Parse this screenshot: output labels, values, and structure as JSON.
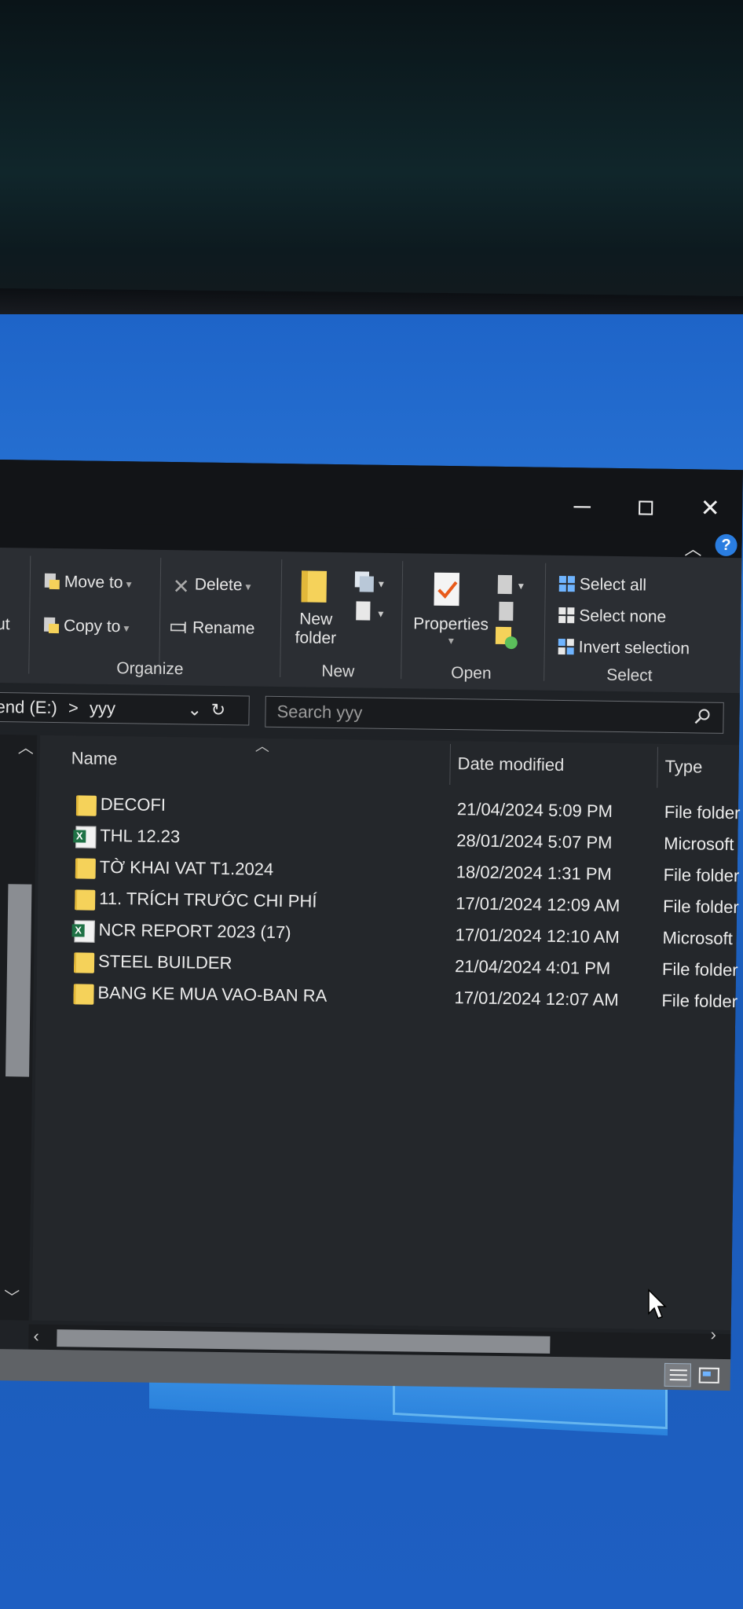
{
  "window": {
    "minimize_glyph": "─",
    "close_glyph": "✕"
  },
  "ribbon": {
    "cut_partial": "ut",
    "move_to": "Move to",
    "copy_to": "Copy to",
    "delete": "Delete",
    "rename": "Rename",
    "new_folder_line1": "New",
    "new_folder_line2": "folder",
    "properties": "Properties",
    "select_all": "Select all",
    "select_none": "Select none",
    "invert_selection": "Invert selection",
    "groups": {
      "organize": "Organize",
      "new": "New",
      "open": "Open",
      "select": "Select"
    }
  },
  "address": {
    "drive_partial": "end (E:)",
    "separator": ">",
    "folder": "yyy"
  },
  "search": {
    "placeholder": "Search yyy"
  },
  "columns": {
    "name": "Name",
    "date_modified": "Date modified",
    "type": "Type"
  },
  "files": [
    {
      "name": "DECOFI",
      "date": "21/04/2024 5:09 PM",
      "type": "File folder",
      "icon": "folder-icon"
    },
    {
      "name": "THL 12.23",
      "date": "28/01/2024 5:07 PM",
      "type": "Microsoft",
      "icon": "excel-file-icon"
    },
    {
      "name": "TỜ KHAI VAT T1.2024",
      "date": "18/02/2024 1:31 PM",
      "type": "File folder",
      "icon": "folder-icon"
    },
    {
      "name": "11. TRÍCH TRƯỚC CHI PHÍ",
      "date": "17/01/2024 12:09 AM",
      "type": "File folder",
      "icon": "folder-icon"
    },
    {
      "name": "NCR REPORT 2023 (17)",
      "date": "17/01/2024 12:10 AM",
      "type": "Microsoft",
      "icon": "excel-file-icon"
    },
    {
      "name": "STEEL BUILDER",
      "date": "21/04/2024 4:01 PM",
      "type": "File folder",
      "icon": "folder-icon"
    },
    {
      "name": "BANG KE MUA VAO-BAN RA",
      "date": "17/01/2024 12:07 AM",
      "type": "File folder",
      "icon": "folder-icon"
    }
  ],
  "colors": {
    "ribbon_bg": "#2b2e33",
    "pane_bg": "#24272b",
    "folder_yellow": "#f5d25a",
    "excel_green": "#1e7145",
    "desktop_blue": "#1e64c8",
    "help_blue": "#2a7de0"
  }
}
